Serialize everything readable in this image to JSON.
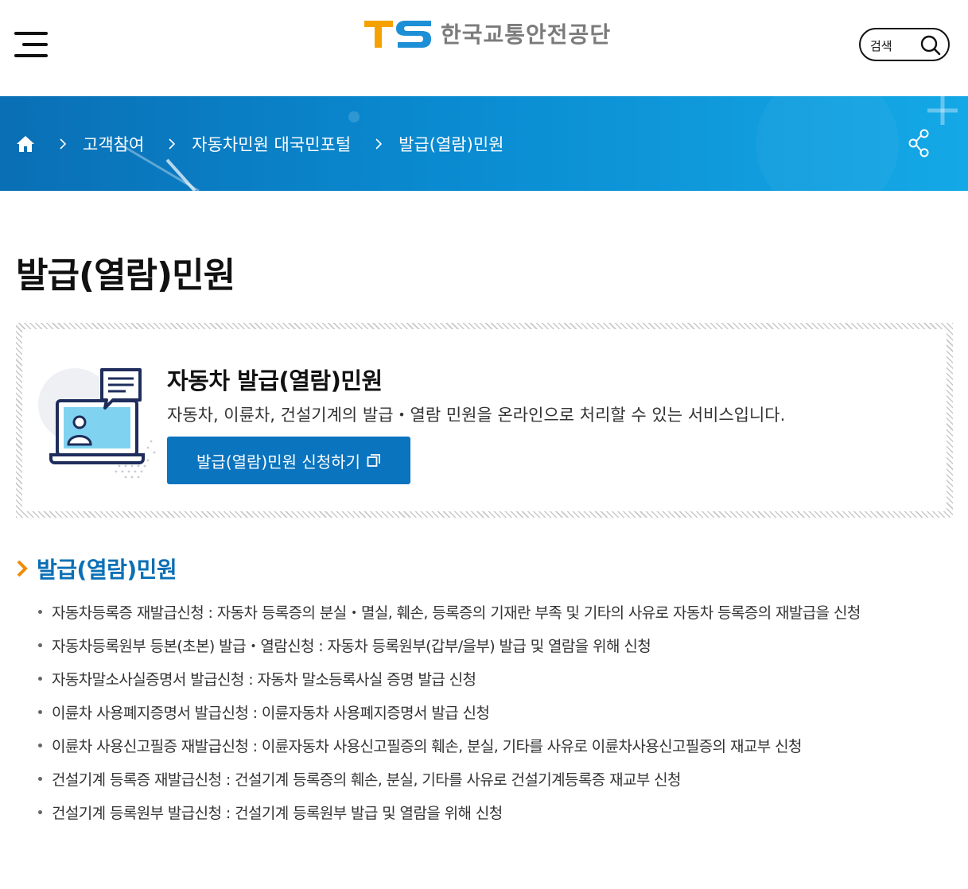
{
  "header": {
    "logo_mark": "TS",
    "logo_text": "한국교통안전공단",
    "search_label": "검색"
  },
  "breadcrumb": {
    "items": [
      "고객참여",
      "자동차민원 대국민포털",
      "발급(열람)민원"
    ]
  },
  "page_title": "발급(열람)민원",
  "info_box": {
    "title": "자동차 발급(열람)민원",
    "description": "자동차, 이륜차, 건설기계의 발급・열람 민원을 온라인으로 처리할 수 있는 서비스입니다.",
    "button_label": "발급(열람)민원 신청하기"
  },
  "section": {
    "title": "발급(열람)민원",
    "items": [
      "자동차등록증 재발급신청 : 자동차 등록증의 분실・멸실, 훼손, 등록증의 기재란 부족 및 기타의 사유로 자동차 등록증의 재발급을 신청",
      "자동차등록원부 등본(초본) 발급・열람신청 : 자동차 등록원부(갑부/을부) 발급 및 열람을 위해 신청",
      "자동차말소사실증명서 발급신청 : 자동차 말소등록사실 증명 발급 신청",
      "이륜차 사용폐지증명서 발급신청 : 이륜자동차 사용폐지증명서 발급 신청",
      "이륜차 사용신고필증 재발급신청 : 이륜자동차 사용신고필증의 훼손, 분실, 기타를 사유로 이륜차사용신고필증의 재교부 신청",
      "건설기계 등록증 재발급신청 : 건설기계 등록증의 훼손, 분실, 기타를 사유로 건설기계등록증 재교부 신청",
      "건설기계 등록원부 발급신청 : 건설기계 등록원부 발급 및 열람을 위해 신청"
    ]
  },
  "colors": {
    "brand_blue": "#0a74bf",
    "banner_start": "#0a6fb5",
    "banner_end": "#14a8e6",
    "logo_orange": "#f5a200",
    "logo_blue": "#1d8fd6",
    "chevron_orange": "#f08c00"
  },
  "icons": {
    "menu": "hamburger-menu-icon",
    "search": "search-icon",
    "home": "home-icon",
    "separator": "chevron-right-icon",
    "share": "share-icon",
    "new_window": "new-window-icon",
    "section_marker": "chevron-right-icon",
    "illustration": "online-counsel-illustration"
  }
}
